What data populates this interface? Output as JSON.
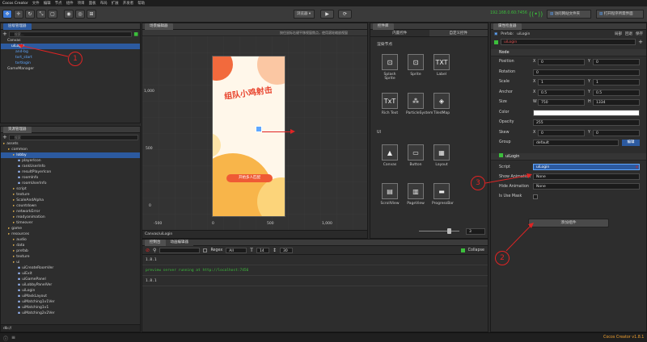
{
  "window": {
    "title": "Cocos Creator",
    "menu": [
      "文件",
      "编辑",
      "节点",
      "组件",
      "项目",
      "面板",
      "布局",
      "扩展",
      "开发者",
      "帮助"
    ],
    "ip": "192.168.0.60:7456",
    "version": "Cocos Creator v1.8.1"
  },
  "toolbar": {
    "platform_select": "浏览器",
    "open_sim_btn": "访问网站文件夹",
    "open_project_btn": "打开程序所需界面"
  },
  "hierarchy": {
    "title": "层级管理器",
    "search_placeholder": "搜索...",
    "items": [
      {
        "label": "Canvas",
        "indent": 1
      },
      {
        "label": "uiLogin",
        "indent": 2,
        "selected": true
      },
      {
        "label": "and-bg",
        "indent": 3
      },
      {
        "label": "txrt_start",
        "indent": 3
      },
      {
        "label": "txrtlogin",
        "indent": 3
      },
      {
        "label": "GameManager",
        "indent": 1
      }
    ]
  },
  "assets": {
    "title": "资源管理器",
    "search_placeholder": "搜索",
    "items": [
      {
        "label": "assets",
        "indent": 0
      },
      {
        "label": "common",
        "indent": 1
      },
      {
        "label": "lobby",
        "indent": 2,
        "selected": true
      },
      {
        "label": "playerIcon",
        "indent": 3
      },
      {
        "label": "rankUserInfo",
        "indent": 3
      },
      {
        "label": "resultPlayerIcon",
        "indent": 3
      },
      {
        "label": "roomInfo",
        "indent": 3
      },
      {
        "label": "roomUserInfo",
        "indent": 3
      },
      {
        "label": "script",
        "indent": 2
      },
      {
        "label": "texture",
        "indent": 2
      },
      {
        "label": "ScaleAndAlpha",
        "indent": 2
      },
      {
        "label": "countdown",
        "indent": 2
      },
      {
        "label": "networkError",
        "indent": 2
      },
      {
        "label": "readyanimation",
        "indent": 2
      },
      {
        "label": "timeover",
        "indent": 2
      },
      {
        "label": "game",
        "indent": 1
      },
      {
        "label": "resources",
        "indent": 1
      },
      {
        "label": "audio",
        "indent": 2
      },
      {
        "label": "data",
        "indent": 2
      },
      {
        "label": "prefab",
        "indent": 2
      },
      {
        "label": "texture",
        "indent": 2
      },
      {
        "label": "ui",
        "indent": 2
      },
      {
        "label": "uiCreateRoomVer",
        "indent": 3
      },
      {
        "label": "uiExit",
        "indent": 3
      },
      {
        "label": "uiGamePanel",
        "indent": 3
      },
      {
        "label": "uiLobbyPanelVer",
        "indent": 3
      },
      {
        "label": "uiLogin",
        "indent": 3
      },
      {
        "label": "uiMaskLayout",
        "indent": 3
      },
      {
        "label": "uiMatching1v1Ver",
        "indent": 3
      },
      {
        "label": "uiMatching1v1",
        "indent": 3
      },
      {
        "label": "uiMatching2v2Ver",
        "indent": 3
      }
    ],
    "footer": "db://"
  },
  "scene": {
    "title": "场景编辑器",
    "hint": "按住鼠标右键平移视窗焦点，使用滚轮缩放视窗",
    "axis_left": [
      "1,000",
      "500",
      "0"
    ],
    "axis_bottom": [
      "-500",
      "0",
      "500",
      "1,000"
    ],
    "game_title": "组队小鸡射击",
    "game_button": "开始多人匹配",
    "footer": "Canvas/uiLogin"
  },
  "widgets": {
    "tab_builtin": "内置控件",
    "tab_custom": "自定义控件",
    "panel_title": "控件库",
    "group_render": "渲染节点",
    "group_ui": "UI",
    "render_nodes": [
      {
        "label": "Splash Sprite",
        "icon": "⊡"
      },
      {
        "label": "Sprite",
        "icon": "⊡"
      },
      {
        "label": "Label",
        "icon": "TXT"
      },
      {
        "label": "Rich Text",
        "icon": "TxT"
      },
      {
        "label": "ParticleSystem",
        "icon": "⁂"
      },
      {
        "label": "TiledMap",
        "icon": "◈"
      }
    ],
    "ui_nodes": [
      {
        "label": "Canvas",
        "icon": "▲"
      },
      {
        "label": "Button",
        "icon": "▭"
      },
      {
        "label": "Layout",
        "icon": "▦"
      },
      {
        "label": "ScrollView",
        "icon": "▤"
      },
      {
        "label": "PageView",
        "icon": "▥"
      },
      {
        "label": "ProgressBar",
        "icon": "▬"
      }
    ],
    "slider_value": "3"
  },
  "console": {
    "tab_console": "控制台",
    "tab_anim": "动画编辑器",
    "regex_label": "Regex",
    "level": "All",
    "font_size": "14",
    "line_height": "30",
    "collapse_label": "Collapse",
    "lines": [
      {
        "text": "1.8.1",
        "color": "#cfcfcf"
      },
      {
        "text": "preview server running at http://localhost:7456",
        "color": "#3cbf3c"
      },
      {
        "text": "1.8.1",
        "color": "#cfcfcf"
      }
    ]
  },
  "inspector": {
    "title": "属性检查器",
    "prefab_label": "Prefab:",
    "prefab_value": "uiLogin",
    "prefab_actions": [
      "局部",
      "回退",
      "保存"
    ],
    "node_name": "uiLogin",
    "node_section": "Node",
    "props": {
      "position": {
        "label": "Position",
        "x": "0",
        "y": "0"
      },
      "rotation": {
        "label": "Rotation",
        "value": "0"
      },
      "scale": {
        "label": "Scale",
        "x": "1",
        "y": "1"
      },
      "anchor": {
        "label": "Anchor",
        "x": "0.5",
        "y": "0.5"
      },
      "size": {
        "label": "Size",
        "w": "750",
        "h": "1334"
      },
      "color": {
        "label": "Color"
      },
      "opacity": {
        "label": "Opacity",
        "value": "255"
      },
      "skew": {
        "label": "Skew",
        "x": "0",
        "y": "0"
      },
      "group": {
        "label": "Group",
        "value": "default",
        "edit": "编辑"
      }
    },
    "component_section": "uiLogin",
    "script_label": "Script",
    "script_value": "uiLogin",
    "show_anim_label": "Show Animation",
    "show_anim_value": "None",
    "hide_anim_label": "Hide Animation",
    "hide_anim_value": "None",
    "use_mask_label": "Is Use Mask",
    "add_component": "添加组件"
  },
  "annotations": [
    "1",
    "2",
    "3"
  ],
  "colors": {
    "accent": "#3c7ad9",
    "annotation": "#e02424"
  }
}
